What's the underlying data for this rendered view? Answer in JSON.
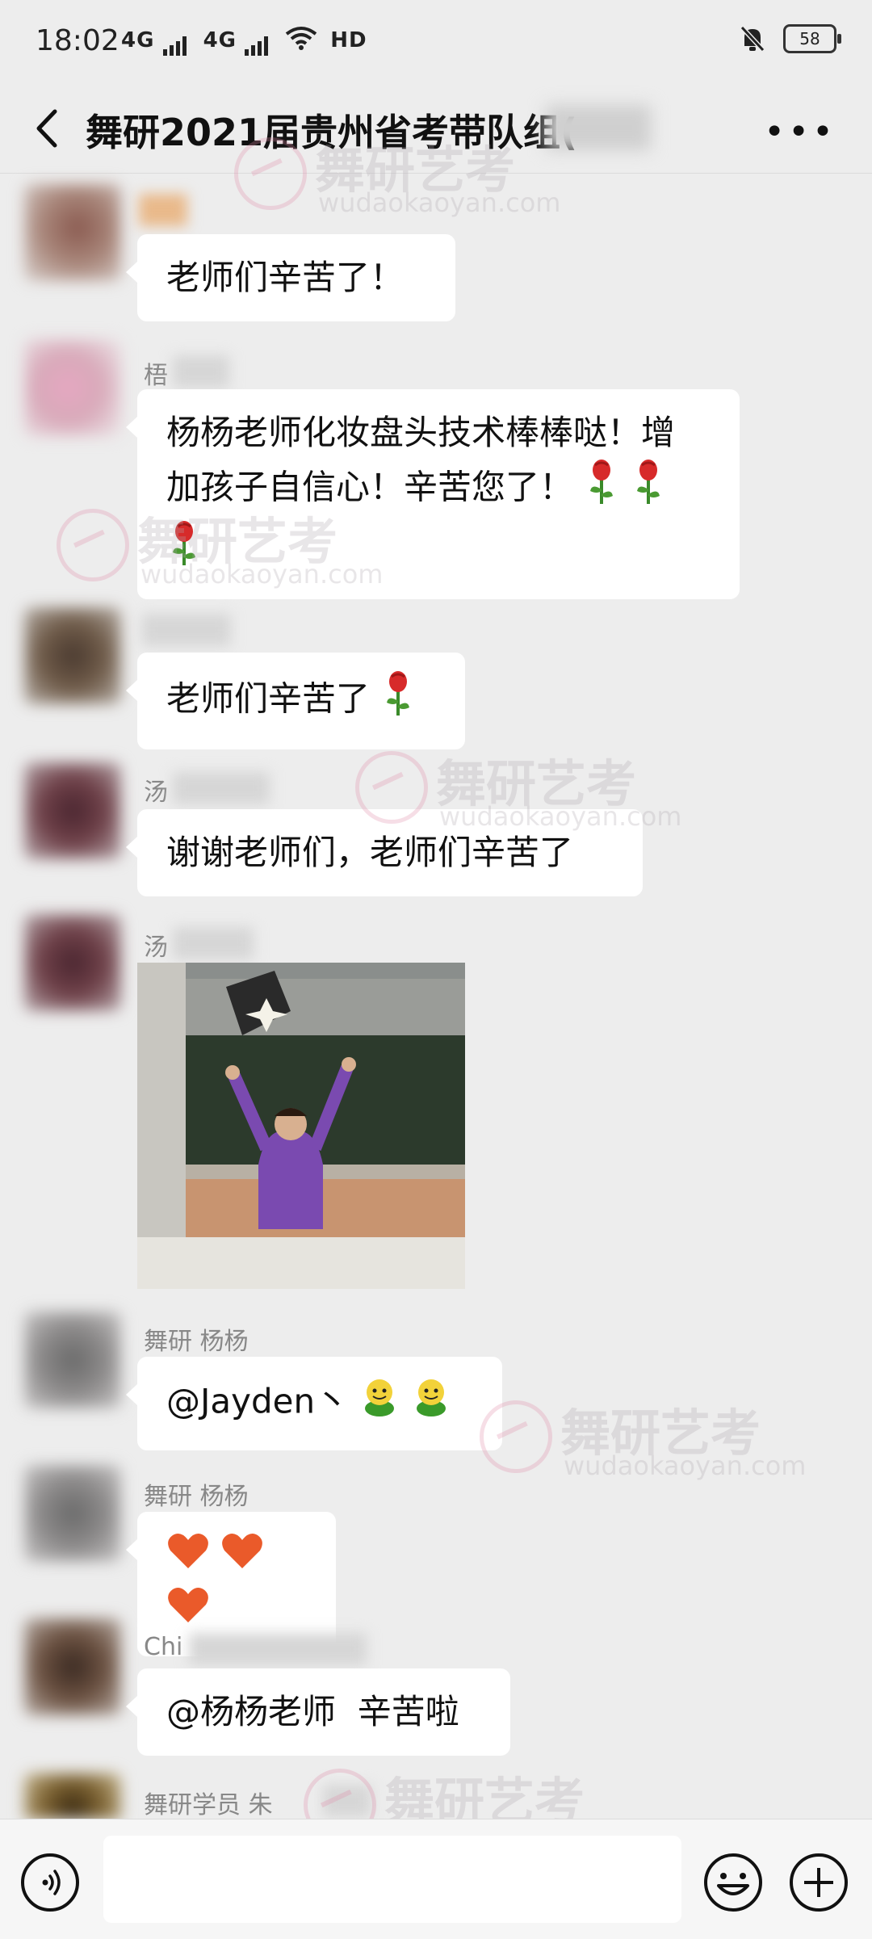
{
  "status_bar": {
    "time": "18:02",
    "network_1": "4G",
    "network_2": "4G",
    "hd": "HD",
    "battery": "58"
  },
  "header": {
    "title": "舞研2021届贵州省考带队组("
  },
  "messages": [
    {
      "sender": "",
      "text": "老师们辛苦了！"
    },
    {
      "sender": "梧",
      "text_line_1": "杨杨老师化妆盘头技术棒棒哒！增",
      "text_line_2": "加孩子自信心！辛苦您了！"
    },
    {
      "sender": "",
      "text": "老师们辛苦了"
    },
    {
      "sender": "汤",
      "text": "谢谢老师们，老师们辛苦了"
    },
    {
      "sender": "汤",
      "image": "photo"
    },
    {
      "sender": "舞研 杨杨",
      "text": "@Jayden丶"
    },
    {
      "sender": "舞研 杨杨",
      "text": ""
    },
    {
      "sender": "Chi",
      "text": "@杨杨老师  辛苦啦"
    },
    {
      "sender": "舞研学员 朱"
    }
  ],
  "watermark": {
    "cn": "舞研艺考",
    "en": "wudaokaoyan.com"
  },
  "icons": {
    "back": "chevron-left-icon",
    "more": "more-dots-icon",
    "rose": "rose-emoji-icon",
    "heart": "heart-emoji-icon",
    "smiley": "green-smiley-emoji-icon",
    "voice": "voice-icon",
    "emoji": "emoji-icon",
    "plus": "plus-icon"
  },
  "colors": {
    "background": "#ededed",
    "bubble": "#ffffff",
    "input_bar": "#f6f6f6"
  }
}
